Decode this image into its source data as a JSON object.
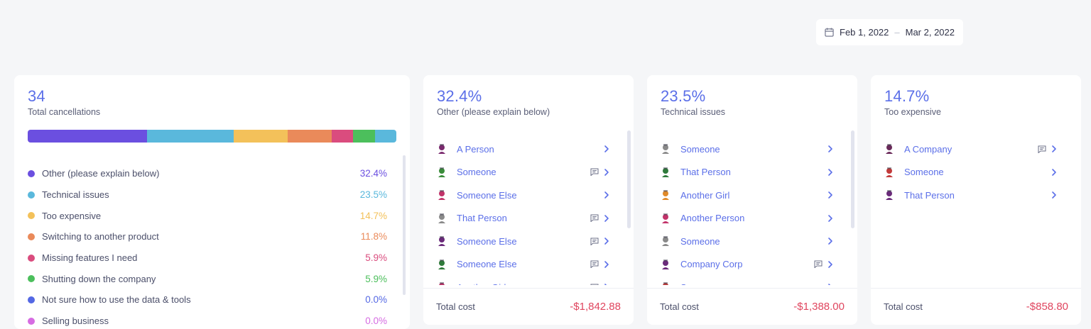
{
  "date_range": {
    "start": "Feb 1, 2022",
    "separator": "–",
    "end": "Mar 2, 2022"
  },
  "summary": {
    "count": "34",
    "label": "Total cancellations",
    "reasons": [
      {
        "label": "Other (please explain below)",
        "pct": "32.4%",
        "value": 32.4,
        "color": "#6b4fe0"
      },
      {
        "label": "Technical issues",
        "pct": "23.5%",
        "value": 23.5,
        "color": "#5ab8dc"
      },
      {
        "label": "Too expensive",
        "pct": "14.7%",
        "value": 14.7,
        "color": "#f3c15a"
      },
      {
        "label": "Switching to another product",
        "pct": "11.8%",
        "value": 11.8,
        "color": "#ea8a5a"
      },
      {
        "label": "Missing features I need",
        "pct": "5.9%",
        "value": 5.9,
        "color": "#da4c7e"
      },
      {
        "label": "Shutting down the company",
        "pct": "5.9%",
        "value": 5.9,
        "color": "#4cbf5c"
      },
      {
        "label": "Not sure how to use the data & tools",
        "pct": "0.0%",
        "value": 0.0,
        "color": "#5468e4"
      },
      {
        "label": "Selling business",
        "pct": "0.0%",
        "value": 0.0,
        "color": "#d66ce2"
      }
    ],
    "bar_tail_color": "#5ab8dc"
  },
  "cards": [
    {
      "pct": "32.4%",
      "label": "Other (please explain below)",
      "total_label": "Total cost",
      "total": "-$1,842.88",
      "people": [
        {
          "name": "A Person",
          "avatar_color": "#7a2a6e",
          "comment": false
        },
        {
          "name": "Someone",
          "avatar_color": "#3a8c3a",
          "comment": true
        },
        {
          "name": "Someone Else",
          "avatar_color": "#c2336a",
          "comment": false
        },
        {
          "name": "That Person",
          "avatar_color": "#8a8a8a",
          "comment": true
        },
        {
          "name": "Someone Else",
          "avatar_color": "#6a2a7a",
          "comment": true
        },
        {
          "name": "Someone Else",
          "avatar_color": "#2f7a3a",
          "comment": true
        },
        {
          "name": "Another Girl",
          "avatar_color": "#c2336a",
          "comment": true
        }
      ]
    },
    {
      "pct": "23.5%",
      "label": "Technical issues",
      "total_label": "Total cost",
      "total": "-$1,388.00",
      "people": [
        {
          "name": "Someone",
          "avatar_color": "#8a8a8a",
          "comment": false
        },
        {
          "name": "That Person",
          "avatar_color": "#2f7a3a",
          "comment": false
        },
        {
          "name": "Another Girl",
          "avatar_color": "#e08a2a",
          "comment": false
        },
        {
          "name": "Another Person",
          "avatar_color": "#c2336a",
          "comment": false
        },
        {
          "name": "Someone",
          "avatar_color": "#8a8a8a",
          "comment": false
        },
        {
          "name": "Company Corp",
          "avatar_color": "#6a2a7a",
          "comment": true
        },
        {
          "name": "Someone",
          "avatar_color": "#c23a3a",
          "comment": false
        }
      ]
    },
    {
      "pct": "14.7%",
      "label": "Too expensive",
      "total_label": "Total cost",
      "total": "-$858.80",
      "people": [
        {
          "name": "A Company",
          "avatar_color": "#6a2a5a",
          "comment": true
        },
        {
          "name": "Someone",
          "avatar_color": "#c23a3a",
          "comment": false
        },
        {
          "name": "That Person",
          "avatar_color": "#6a2a7a",
          "comment": false
        }
      ]
    }
  ],
  "icons": {
    "calendar": "calendar-icon",
    "comment": "comment-icon",
    "chevron": "chevron-right-icon",
    "avatar": "avatar-icon"
  }
}
